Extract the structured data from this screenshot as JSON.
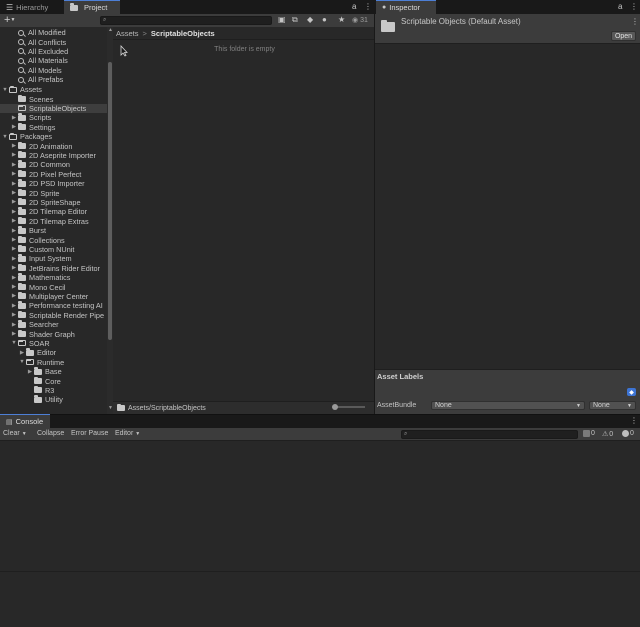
{
  "hierarchy_tab": {
    "label": "Hierarchy"
  },
  "project_tab": {
    "label": "Project"
  },
  "inspector_tab": {
    "label": "Inspector"
  },
  "console_tab": {
    "label": "Console"
  },
  "project_toolbar": {
    "add_label": "+",
    "hidden_count": "31"
  },
  "favorites": [
    "All Modified",
    "All Conflicts",
    "All Excluded",
    "All Materials",
    "All Models",
    "All Prefabs"
  ],
  "assets_root": {
    "label": "Assets"
  },
  "asset_children": [
    "Scenes",
    "ScriptableObjects",
    "Scripts",
    "Settings"
  ],
  "packages_root": {
    "label": "Packages"
  },
  "packages": [
    "2D Animation",
    "2D Aseprite Importer",
    "2D Common",
    "2D Pixel Perfect",
    "2D PSD Importer",
    "2D Sprite",
    "2D SpriteShape",
    "2D Tilemap Editor",
    "2D Tilemap Extras",
    "Burst",
    "Collections",
    "Custom NUnit",
    "Input System",
    "JetBrains Rider Editor",
    "Mathematics",
    "Mono Cecil",
    "Multiplayer Center",
    "Performance testing AI",
    "Scriptable Render Pipe",
    "Searcher",
    "Shader Graph",
    "SOAR"
  ],
  "soar_children": {
    "editor": "Editor",
    "runtime": "Runtime"
  },
  "runtime_children": [
    "Base",
    "Core",
    "R3",
    "Utility"
  ],
  "breadcrumb": {
    "root": "Assets",
    "sep": ">",
    "current": "ScriptableObjects"
  },
  "empty_message": "This folder is empty",
  "path_bar": {
    "path": "Assets/ScriptableObjects"
  },
  "inspector": {
    "title": "Scriptable Objects (Default Asset)",
    "open_label": "Open",
    "asset_labels": "Asset Labels",
    "asset_bundle_label": "AssetBundle",
    "bundle_value": "None",
    "variant_value": "None"
  },
  "console": {
    "clear": "Clear",
    "collapse": "Collapse",
    "error_pause": "Error Pause",
    "editor": "Editor",
    "log_count": "0",
    "warn_count": "0",
    "error_count": "0"
  },
  "colors": {
    "accent": "#4d7fd6",
    "panel": "#282828",
    "tabbar": "#191919",
    "toolbar": "#3c3c3c"
  }
}
